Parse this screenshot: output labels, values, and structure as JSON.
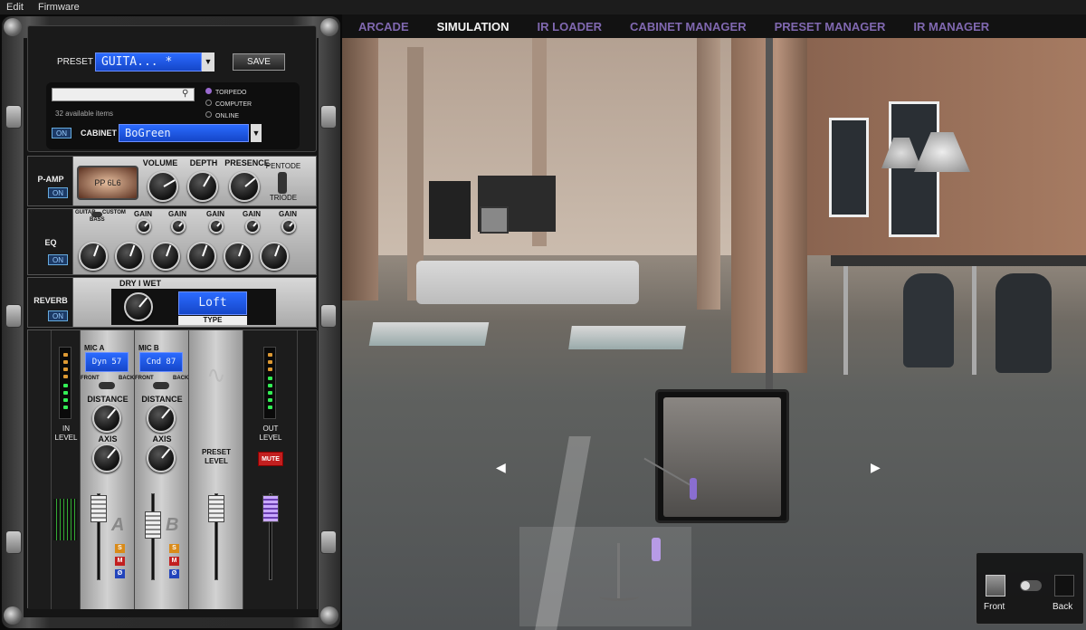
{
  "menu": [
    "Edit",
    "Firmware"
  ],
  "tabs": [
    {
      "label": "ARCADE",
      "active": false
    },
    {
      "label": "SIMULATION",
      "active": true
    },
    {
      "label": "IR LOADER",
      "active": false
    },
    {
      "label": "CABINET MANAGER",
      "active": false
    },
    {
      "label": "PRESET MANAGER",
      "active": false
    },
    {
      "label": "IR MANAGER",
      "active": false
    }
  ],
  "preset": {
    "label": "PRESET",
    "name": "GUITA...   *",
    "save_label": "SAVE",
    "search_placeholder": "",
    "available": "32 available items",
    "sources": [
      "TORPEDO",
      "COMPUTER",
      "ONLINE"
    ],
    "selected_source": "TORPEDO",
    "on_label": "ON",
    "cabinet_label": "CABINET",
    "cabinet_name": "BoGreen"
  },
  "pamp": {
    "title": "P-AMP",
    "on_label": "ON",
    "tube": "PP 6L6",
    "knobs": [
      "VOLUME",
      "DEPTH",
      "PRESENCE"
    ],
    "pentode": "PENTODE",
    "triode": "TRIODE"
  },
  "eq": {
    "title": "EQ",
    "on_label": "ON",
    "guitar": "GUITAR",
    "custom": "CUSTOM",
    "bass": "BASS",
    "gain_labels": [
      "GAIN",
      "GAIN",
      "GAIN",
      "GAIN",
      "GAIN"
    ]
  },
  "reverb": {
    "title": "REVERB",
    "on_label": "ON",
    "dry_wet": "DRY I WET",
    "type_value": "Loft",
    "type_label": "TYPE"
  },
  "mixer": {
    "in_level": "IN\nLEVEL",
    "mic_a": {
      "title": "MIC A",
      "model": "Dyn 57",
      "front": "FRONT",
      "back": "BACK",
      "distance": "DISTANCE",
      "axis": "AXIS",
      "letter": "A"
    },
    "mic_b": {
      "title": "MIC B",
      "model": "Cnd 87",
      "front": "FRONT",
      "back": "BACK",
      "distance": "DISTANCE",
      "axis": "AXIS",
      "letter": "B"
    },
    "preset_level": "PRESET\nLEVEL",
    "out_level": "OUT\nLEVEL",
    "mute": "MUTE",
    "buttons": [
      "S",
      "M",
      "Ø"
    ]
  },
  "view": {
    "front": "Front",
    "back": "Back"
  },
  "colors": {
    "accent_tab": "#8068b0",
    "lcd_blue": "#1e5be6",
    "mute_red": "#c21f1f"
  }
}
